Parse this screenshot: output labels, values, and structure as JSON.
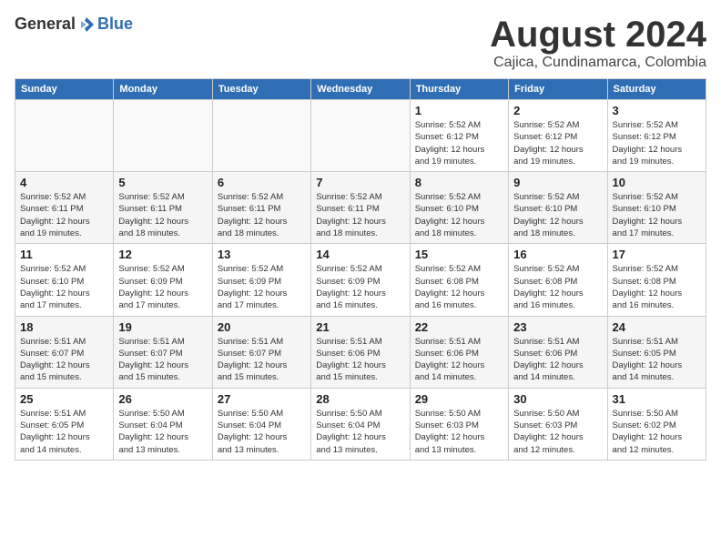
{
  "header": {
    "logo_general": "General",
    "logo_blue": "Blue",
    "month_title": "August 2024",
    "location": "Cajica, Cundinamarca, Colombia"
  },
  "calendar": {
    "weekdays": [
      "Sunday",
      "Monday",
      "Tuesday",
      "Wednesday",
      "Thursday",
      "Friday",
      "Saturday"
    ],
    "weeks": [
      [
        {
          "day": "",
          "info": ""
        },
        {
          "day": "",
          "info": ""
        },
        {
          "day": "",
          "info": ""
        },
        {
          "day": "",
          "info": ""
        },
        {
          "day": "1",
          "info": "Sunrise: 5:52 AM\nSunset: 6:12 PM\nDaylight: 12 hours\nand 19 minutes."
        },
        {
          "day": "2",
          "info": "Sunrise: 5:52 AM\nSunset: 6:12 PM\nDaylight: 12 hours\nand 19 minutes."
        },
        {
          "day": "3",
          "info": "Sunrise: 5:52 AM\nSunset: 6:12 PM\nDaylight: 12 hours\nand 19 minutes."
        }
      ],
      [
        {
          "day": "4",
          "info": "Sunrise: 5:52 AM\nSunset: 6:11 PM\nDaylight: 12 hours\nand 19 minutes."
        },
        {
          "day": "5",
          "info": "Sunrise: 5:52 AM\nSunset: 6:11 PM\nDaylight: 12 hours\nand 18 minutes."
        },
        {
          "day": "6",
          "info": "Sunrise: 5:52 AM\nSunset: 6:11 PM\nDaylight: 12 hours\nand 18 minutes."
        },
        {
          "day": "7",
          "info": "Sunrise: 5:52 AM\nSunset: 6:11 PM\nDaylight: 12 hours\nand 18 minutes."
        },
        {
          "day": "8",
          "info": "Sunrise: 5:52 AM\nSunset: 6:10 PM\nDaylight: 12 hours\nand 18 minutes."
        },
        {
          "day": "9",
          "info": "Sunrise: 5:52 AM\nSunset: 6:10 PM\nDaylight: 12 hours\nand 18 minutes."
        },
        {
          "day": "10",
          "info": "Sunrise: 5:52 AM\nSunset: 6:10 PM\nDaylight: 12 hours\nand 17 minutes."
        }
      ],
      [
        {
          "day": "11",
          "info": "Sunrise: 5:52 AM\nSunset: 6:10 PM\nDaylight: 12 hours\nand 17 minutes."
        },
        {
          "day": "12",
          "info": "Sunrise: 5:52 AM\nSunset: 6:09 PM\nDaylight: 12 hours\nand 17 minutes."
        },
        {
          "day": "13",
          "info": "Sunrise: 5:52 AM\nSunset: 6:09 PM\nDaylight: 12 hours\nand 17 minutes."
        },
        {
          "day": "14",
          "info": "Sunrise: 5:52 AM\nSunset: 6:09 PM\nDaylight: 12 hours\nand 16 minutes."
        },
        {
          "day": "15",
          "info": "Sunrise: 5:52 AM\nSunset: 6:08 PM\nDaylight: 12 hours\nand 16 minutes."
        },
        {
          "day": "16",
          "info": "Sunrise: 5:52 AM\nSunset: 6:08 PM\nDaylight: 12 hours\nand 16 minutes."
        },
        {
          "day": "17",
          "info": "Sunrise: 5:52 AM\nSunset: 6:08 PM\nDaylight: 12 hours\nand 16 minutes."
        }
      ],
      [
        {
          "day": "18",
          "info": "Sunrise: 5:51 AM\nSunset: 6:07 PM\nDaylight: 12 hours\nand 15 minutes."
        },
        {
          "day": "19",
          "info": "Sunrise: 5:51 AM\nSunset: 6:07 PM\nDaylight: 12 hours\nand 15 minutes."
        },
        {
          "day": "20",
          "info": "Sunrise: 5:51 AM\nSunset: 6:07 PM\nDaylight: 12 hours\nand 15 minutes."
        },
        {
          "day": "21",
          "info": "Sunrise: 5:51 AM\nSunset: 6:06 PM\nDaylight: 12 hours\nand 15 minutes."
        },
        {
          "day": "22",
          "info": "Sunrise: 5:51 AM\nSunset: 6:06 PM\nDaylight: 12 hours\nand 14 minutes."
        },
        {
          "day": "23",
          "info": "Sunrise: 5:51 AM\nSunset: 6:06 PM\nDaylight: 12 hours\nand 14 minutes."
        },
        {
          "day": "24",
          "info": "Sunrise: 5:51 AM\nSunset: 6:05 PM\nDaylight: 12 hours\nand 14 minutes."
        }
      ],
      [
        {
          "day": "25",
          "info": "Sunrise: 5:51 AM\nSunset: 6:05 PM\nDaylight: 12 hours\nand 14 minutes."
        },
        {
          "day": "26",
          "info": "Sunrise: 5:50 AM\nSunset: 6:04 PM\nDaylight: 12 hours\nand 13 minutes."
        },
        {
          "day": "27",
          "info": "Sunrise: 5:50 AM\nSunset: 6:04 PM\nDaylight: 12 hours\nand 13 minutes."
        },
        {
          "day": "28",
          "info": "Sunrise: 5:50 AM\nSunset: 6:04 PM\nDaylight: 12 hours\nand 13 minutes."
        },
        {
          "day": "29",
          "info": "Sunrise: 5:50 AM\nSunset: 6:03 PM\nDaylight: 12 hours\nand 13 minutes."
        },
        {
          "day": "30",
          "info": "Sunrise: 5:50 AM\nSunset: 6:03 PM\nDaylight: 12 hours\nand 12 minutes."
        },
        {
          "day": "31",
          "info": "Sunrise: 5:50 AM\nSunset: 6:02 PM\nDaylight: 12 hours\nand 12 minutes."
        }
      ]
    ]
  }
}
